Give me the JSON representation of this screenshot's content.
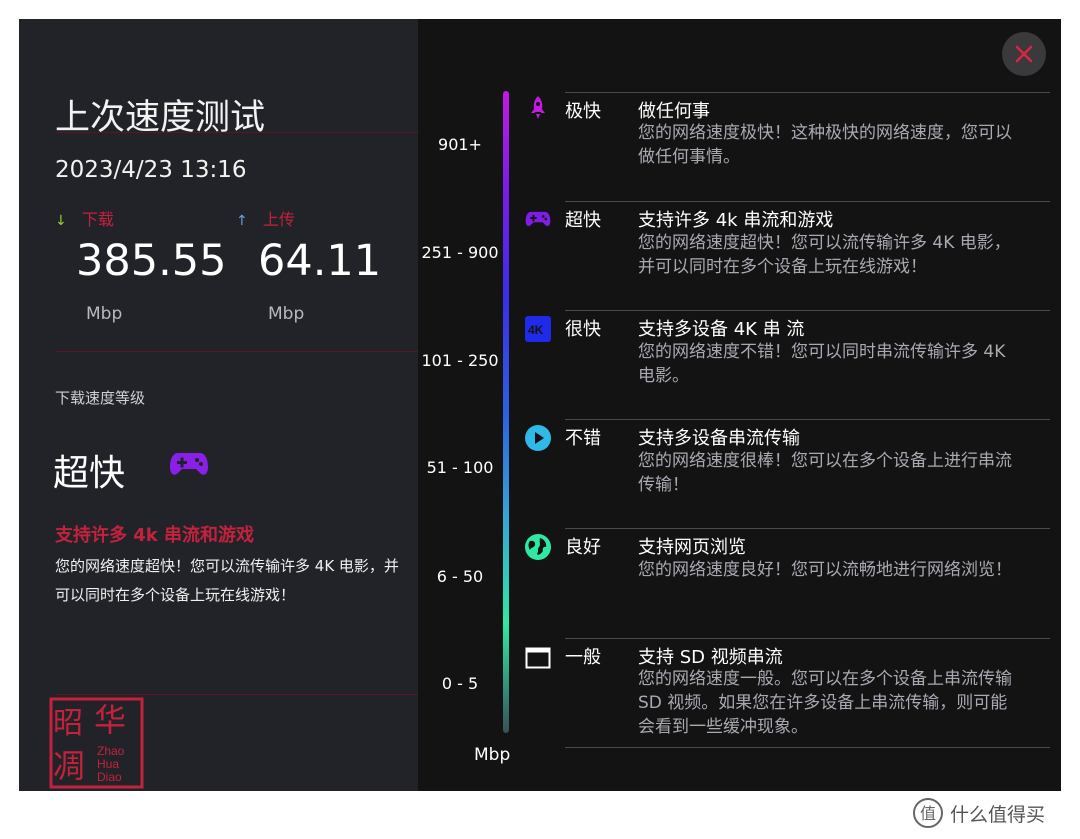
{
  "left": {
    "title": "上次速度测试",
    "datetime": "2023/4/23 13:16",
    "download": {
      "label": "下载",
      "value": "385.55",
      "unit": "Mbp",
      "arrow": "↓"
    },
    "upload": {
      "label": "上传",
      "value": "64.11",
      "unit": "Mbp",
      "arrow": "↑"
    },
    "level_caption": "下载速度等级",
    "level_name": "超快",
    "level_head": "支持许多 4k 串流和游戏",
    "level_desc": "您的网络速度超快！您可以流传输许多 4K 电影，并可以同时在多个设备上玩在线游戏！",
    "seal": {
      "chars_big": [
        "昭",
        "华",
        "凋"
      ],
      "latin": [
        "Zhao",
        "Hua",
        "Diao"
      ],
      "color": "#c3223c"
    }
  },
  "scale": {
    "ticks": [
      "901+",
      "251 - 900",
      "101 - 250",
      "51 - 100",
      "6 - 50",
      "0 - 5"
    ],
    "unit": "Mbp"
  },
  "rows": [
    {
      "icon": "rocket-icon",
      "color": "#c21ae0",
      "level": "极快",
      "title": "做任何事",
      "desc": [
        "您的网络速度极快！这种极快的网络速度，您可以",
        "做任何事情。"
      ]
    },
    {
      "icon": "gamepad-icon",
      "color": "#7f1ce6",
      "level": "超快",
      "title": "支持许多 4k 串流和游戏",
      "desc": [
        "您的网络速度超快！您可以流传输许多 4K 电影，",
        "并可以同时在多个设备上玩在线游戏！"
      ]
    },
    {
      "icon": "4k-icon",
      "color": "#1f2be8",
      "level": "很快",
      "title": "支持多设备 4K 串 流",
      "desc": [
        "您的网络速度不错！您可以同时串流传输许多 4K",
        "电影。"
      ]
    },
    {
      "icon": "play-icon",
      "color": "#2fb8e8",
      "level": "不错",
      "title": "支持多设备串流传输",
      "desc": [
        "您的网络速度很棒！您可以在多个设备上进行串流",
        "传输！"
      ]
    },
    {
      "icon": "globe-icon",
      "color": "#2ee9a3",
      "level": "良好",
      "title": "支持网页浏览",
      "desc": [
        "您的网络速度良好！您可以流畅地进行网络浏览！"
      ]
    },
    {
      "icon": "window-icon",
      "color": "#ffffff",
      "level": "一般",
      "title": "支持 SD 视频串流",
      "desc": [
        "您的网络速度一般。您可以在多个设备上串流传输",
        "SD 视频。如果您在许多设备上串流传输，则可能",
        "会看到一些缓冲现象。"
      ]
    }
  ],
  "close": {
    "color": "#e2233f"
  },
  "watermark": {
    "text": "什么值得买"
  }
}
